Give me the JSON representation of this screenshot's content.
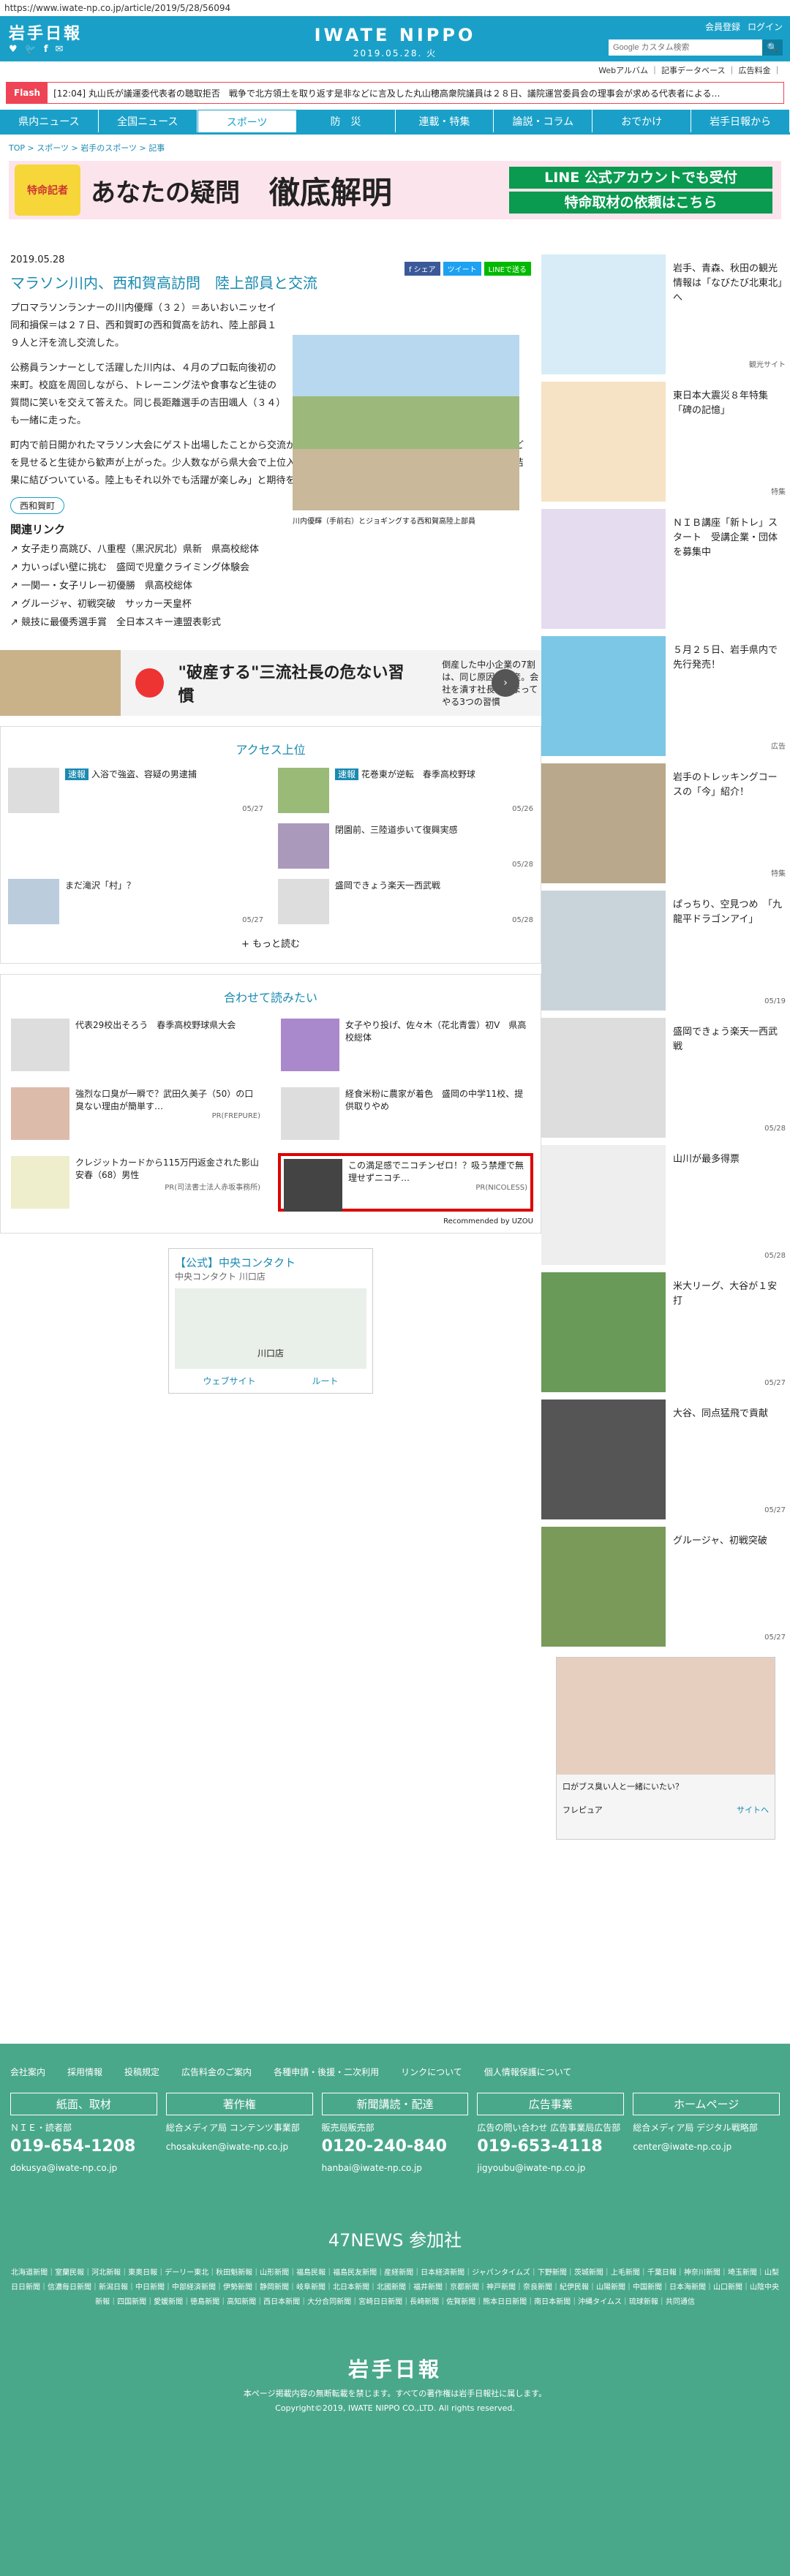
{
  "url": "https://www.iwate-np.co.jp/article/2019/5/28/56094",
  "header": {
    "logo": "岩手日報",
    "brand": "IWATE NIPPO",
    "date": "2019.05.28. 火",
    "links": [
      "会員登録",
      "ログイン"
    ],
    "search_placeholder": "Google カスタム検索",
    "search_button": "🔍",
    "social": [
      "♥",
      "🐦",
      "f",
      "✉"
    ],
    "sub": "Webアルバム ｜ 記事データベース ｜ 広告料金 ｜"
  },
  "flash": {
    "label": "Flash",
    "text": "[12:04] 丸山氏が議運委代表者の聴取拒否　戦争で北方領土を取り返す是非などに言及した丸山穂高衆院議員は２８日、議院運営委員会の理事会が求める代表者による…"
  },
  "nav": [
    "県内ニュース",
    "全国ニュース",
    "スポーツ",
    "防　災",
    "連載・特集",
    "論説・コラム",
    "おでかけ",
    "岩手日報から"
  ],
  "breadcrumb": "TOP > スポーツ > 岩手のスポーツ > 記事",
  "banner": {
    "b1": "特命記者",
    "b2": "あなたの疑問",
    "b3": "徹底解明",
    "b4": [
      "LINE 公式アカウントでも受付",
      "特命取材の依頼はこちら"
    ]
  },
  "article": {
    "date": "2019.05.28",
    "share": [
      "f シェア",
      "ツイート",
      "LINEで送る"
    ],
    "title": "マラソン川内、西和賀高訪問　陸上部員と交流",
    "caption": "川内優輝（手前右）とジョギングする西和賀高陸上部員",
    "p1": "プロマラソンランナーの川内優輝（３２）＝あいおいニッセイ同和損保＝は２７日、西和賀町の西和賀高を訪れ、陸上部員１９人と汗を流し交流した。",
    "p2": "公務員ランナーとして活躍した川内は、４月のプロ転向後初の来町。校庭を周回しながら、トレーニング法や食事など生徒の質問に笑いを交えて答えた。同じ長距離選手の吉田颯人（３４）も一緒に走った。",
    "p3": "町内で前日開かれたマラソン大会にゲスト出場したことから交流が実現した。昨年のボストン・マラソンの金メダルなどを見せると生徒から歓声が上がった。少人数ながら県大会で上位入賞する同部に、川内は「みんなの前向きな気持ちが結果に結びついている。陸上もそれ以外でも活躍が楽しみ」と期待を寄せた。",
    "tag": "西和賀町"
  },
  "related": {
    "heading": "関連リンク",
    "items": [
      "女子走り高跳び、八重樫（黒沢尻北）県新　県高校総体",
      "力いっぱい壁に挑む　盛岡で児童クライミング体験会",
      "一関一・女子リレー初優勝　県高校総体",
      "グルージャ、初戦突破　サッカー天皇杯",
      "競技に最優秀選手賞　全日本スキー連盟表彰式"
    ]
  },
  "ad1": {
    "title": "\"破産する\"三流社長の危ない習慣",
    "sub": "倒産した中小企業の7割は、同じ原因で倒産。会社を潰す社長が決まってやる3つの習慣"
  },
  "ranking": {
    "heading": "アクセス上位",
    "items": [
      {
        "badge": "速報",
        "title": "入浴で強盗、容疑の男逮捕",
        "date": "05/27"
      },
      {
        "badge": "速報",
        "title": "花巻東が逆転　春季高校野球",
        "date": "05/26"
      },
      {
        "badge": "",
        "title": "",
        "date": ""
      },
      {
        "badge": "",
        "title": "閉園前、三陸道歩いて復興実感",
        "date": "05/28"
      },
      {
        "badge": "",
        "title": "まだ滝沢「村」？",
        "date": "05/27"
      },
      {
        "badge": "",
        "title": "盛岡できょう楽天一西武戦",
        "date": "05/28"
      }
    ],
    "more": "+ もっと読む"
  },
  "recommend": {
    "heading": "合わせて読みたい",
    "items": [
      {
        "title": "代表29校出そろう　春季高校野球県大会",
        "pr": ""
      },
      {
        "title": "女子やり投げ、佐々木（花北青雲）初V　県高校総体",
        "pr": ""
      },
      {
        "title": "強烈な口臭が一瞬で？武田久美子（50）の口臭ない理由が簡単す…",
        "pr": "PR(FREPURE)"
      },
      {
        "title": "経食米粉に農家が着色　盛岡の中学11校、提供取りやめ",
        "pr": ""
      },
      {
        "title": "クレジットカードから115万円返金された影山安春（68）男性",
        "pr": "PR(司法書士法人赤坂事務所)"
      },
      {
        "title": "この満足感でニコチンゼロ！？吸う禁煙で無理せずニコチ…",
        "pr": "PR(NICOLESS)"
      }
    ],
    "powered": "Recommended by UZOU"
  },
  "ad2": {
    "title": "【公式】中央コンタクト",
    "sub": "中央コンタクト 川口店",
    "map": "川口店",
    "btns": [
      "ウェブサイト",
      "ルート"
    ]
  },
  "side": [
    {
      "text": "岩手、青森、秋田の観光情報は「なびたび北東北」へ",
      "date": "観光サイト"
    },
    {
      "text": "東日本大震災８年特集「碑の記憶」",
      "date": "特集"
    },
    {
      "text": "ＮＩＢ講座「新トレ」スタート　受講企業・団体を募集中",
      "date": ""
    },
    {
      "text": "５月２５日、岩手県内で先行発売！",
      "date": "広告"
    },
    {
      "text": "岩手のトレッキングコースの「今」紹介！",
      "date": "特集"
    },
    {
      "text": "ぱっちり、空見つめ　「九龍平ドラゴンアイ」",
      "date": "05/19"
    },
    {
      "text": "盛岡できょう楽天一西武戦",
      "date": "05/28"
    },
    {
      "text": "山川が最多得票",
      "date": "05/28"
    },
    {
      "text": "米大リーグ、大谷が１安打",
      "date": "05/27"
    },
    {
      "text": "大谷、同点猛飛で貢献",
      "date": "05/27"
    },
    {
      "text": "グルージャ、初戦突破",
      "date": "05/27"
    }
  ],
  "side_ad": {
    "text": "口がブス臭い人と一緒にいたい？",
    "brand": "フレピュア",
    "link": "サイトへ"
  },
  "footer": {
    "links": [
      "会社案内",
      "採用情報",
      "投稿規定",
      "広告料金のご案内",
      "各種申請・後援・二次利用",
      "リンクについて",
      "個人情報保護について"
    ],
    "cols": [
      {
        "h": "紙面、取材",
        "t": "ＮＩＥ・読者部",
        "tel": "019-654-1208",
        "m": "dokusya@iwate-np.co.jp"
      },
      {
        "h": "著作権",
        "t": "総合メディア局 コンテンツ事業部",
        "tel": "",
        "m": "chosakuken@iwate-np.co.jp"
      },
      {
        "h": "新聞講読・配達",
        "t": "販売局販売部",
        "tel": "0120-240-840",
        "m": "hanbai@iwate-np.co.jp"
      },
      {
        "h": "広告事業",
        "t": "広告の問い合わせ 広告事業局広告部",
        "tel": "019-653-4118",
        "m": "jigyoubu@iwate-np.co.jp"
      },
      {
        "h": "ホームページ",
        "t": "総合メディア局 デジタル戦略部",
        "tel": "",
        "m": "center@iwate-np.co.jp"
      }
    ],
    "news47": "47NEWS 参加社",
    "members": "北海道新聞｜室蘭民報｜河北新報｜東奥日報｜デーリー東北｜秋田魁新報｜山形新聞｜福島民報｜福島民友新聞｜産経新聞｜日本経済新聞｜ジャパンタイムズ｜下野新聞｜茨城新聞｜上毛新聞｜千葉日報｜神奈川新聞｜埼玉新聞｜山梨日日新聞｜信濃毎日新聞｜新潟日報｜中日新聞｜中部経済新聞｜伊勢新聞｜静岡新聞｜岐阜新聞｜北日本新聞｜北國新聞｜福井新聞｜京都新聞｜神戸新聞｜奈良新聞｜紀伊民報｜山陽新聞｜中国新聞｜日本海新聞｜山口新聞｜山陰中央新報｜四国新聞｜愛媛新聞｜徳島新聞｜高知新聞｜西日本新聞｜大分合同新聞｜宮崎日日新聞｜長崎新聞｜佐賀新聞｜熊本日日新聞｜南日本新聞｜沖縄タイムス｜琉球新報｜共同通信",
    "logo": "岩手日報",
    "copy1": "本ページ掲載内容の無断転載を禁じます。すべての著作権は岩手日報社に属します。",
    "copy2": "Copyright©2019, IWATE NIPPO CO.,LTD. All rights reserved."
  }
}
